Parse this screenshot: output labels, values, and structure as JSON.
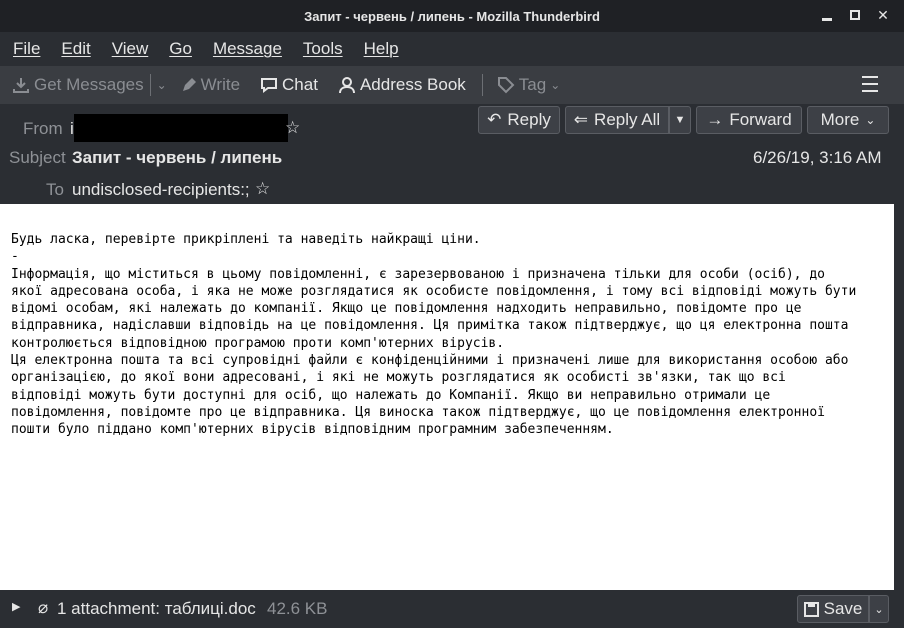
{
  "window": {
    "title": "Запит - червень / липень - Mozilla Thunderbird"
  },
  "menu": [
    "File",
    "Edit",
    "View",
    "Go",
    "Message",
    "Tools",
    "Help"
  ],
  "toolbar": {
    "get_messages": "Get Messages",
    "write": "Write",
    "chat": "Chat",
    "address_book": "Address Book",
    "tag": "Tag"
  },
  "header": {
    "from_label": "From",
    "from_value": "i",
    "subject_label": "Subject",
    "subject_value": "Запит - червень / липень",
    "to_label": "To",
    "to_value": "undisclosed-recipients:;",
    "date": "6/26/19, 3:16 AM",
    "reply": "Reply",
    "reply_all": "Reply All",
    "forward": "Forward",
    "more": "More"
  },
  "body": {
    "lines": [
      "Будь ласка, перевірте прикріплені та наведіть найкращі ціни.",
      "",
      "",
      "-",
      "",
      "Інформація, що міститься в цьому повідомленні, є зарезервованою і призначена тільки для особи (осіб), до",
      "якої адресована особа, і яка не може розглядатися як особисте повідомлення, і тому всі відповіді можуть бути",
      "відомі особам, які належать до компанії. Якщо це повідомлення надходить неправильно, повідомте про це",
      "відправника, надіславши відповідь на це повідомлення. Ця примітка також підтверджує, що ця електронна пошта",
      "контролюється відповідною програмою проти комп'ютерних вірусів.",
      "",
      "Ця електронна пошта та всі супровідні файли є конфіденційними і призначені лише для використання особою або",
      "організацією, до якої вони адресовані, і які не можуть розглядатися як особисті зв'язки, так що всі",
      "відповіді можуть бути доступні для осіб, що належать до Компанії. Якщо ви неправильно отримали це",
      "повідомлення, повідомте про це відправника. Ця виноска також підтверджує, що це повідомлення електронної",
      "пошти було піддано комп'ютерних вірусів відповідним програмним забезпеченням."
    ]
  },
  "attachment": {
    "summary": "1 attachment: таблиці.doc",
    "size": "42.6 KB",
    "save": "Save"
  }
}
